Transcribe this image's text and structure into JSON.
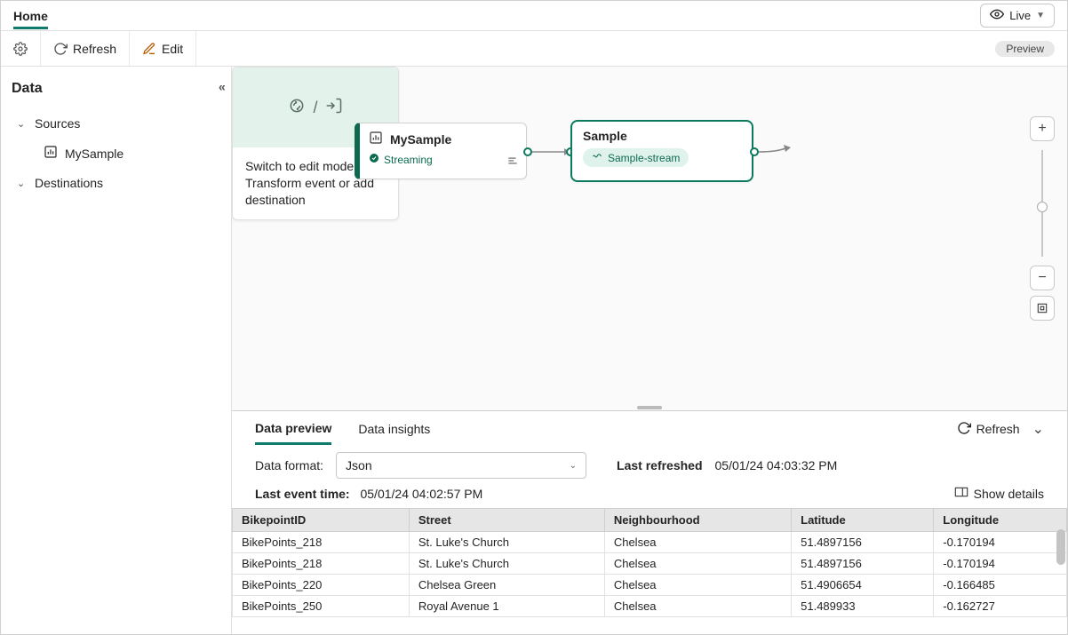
{
  "topbar": {
    "home_tab": "Home",
    "live_label": "Live"
  },
  "toolbar": {
    "refresh_label": "Refresh",
    "edit_label": "Edit",
    "preview_badge": "Preview"
  },
  "sidebar": {
    "title": "Data",
    "sources_label": "Sources",
    "destinations_label": "Destinations",
    "source_item": "MySample"
  },
  "canvas": {
    "source_node": {
      "title": "MySample",
      "status": "Streaming"
    },
    "mid_node": {
      "title": "Sample",
      "stream_chip": "Sample-stream"
    },
    "dest_node": {
      "message": "Switch to edit mode to Transform event or add destination",
      "slash": "/"
    }
  },
  "bottom": {
    "tab_preview": "Data preview",
    "tab_insights": "Data insights",
    "refresh_label": "Refresh",
    "format_label": "Data format:",
    "format_value": "Json",
    "last_refreshed_label": "Last refreshed",
    "last_refreshed_value": "05/01/24 04:03:32 PM",
    "last_event_label": "Last event time:",
    "last_event_value": "05/01/24 04:02:57 PM",
    "show_details": "Show details",
    "columns": [
      "BikepointID",
      "Street",
      "Neighbourhood",
      "Latitude",
      "Longitude"
    ],
    "rows": [
      [
        "BikePoints_218",
        "St. Luke's Church",
        "Chelsea",
        "51.4897156",
        "-0.170194"
      ],
      [
        "BikePoints_218",
        "St. Luke's Church",
        "Chelsea",
        "51.4897156",
        "-0.170194"
      ],
      [
        "BikePoints_220",
        "Chelsea Green",
        "Chelsea",
        "51.4906654",
        "-0.166485"
      ],
      [
        "BikePoints_250",
        "Royal Avenue 1",
        "Chelsea",
        "51.489933",
        "-0.162727"
      ]
    ]
  }
}
